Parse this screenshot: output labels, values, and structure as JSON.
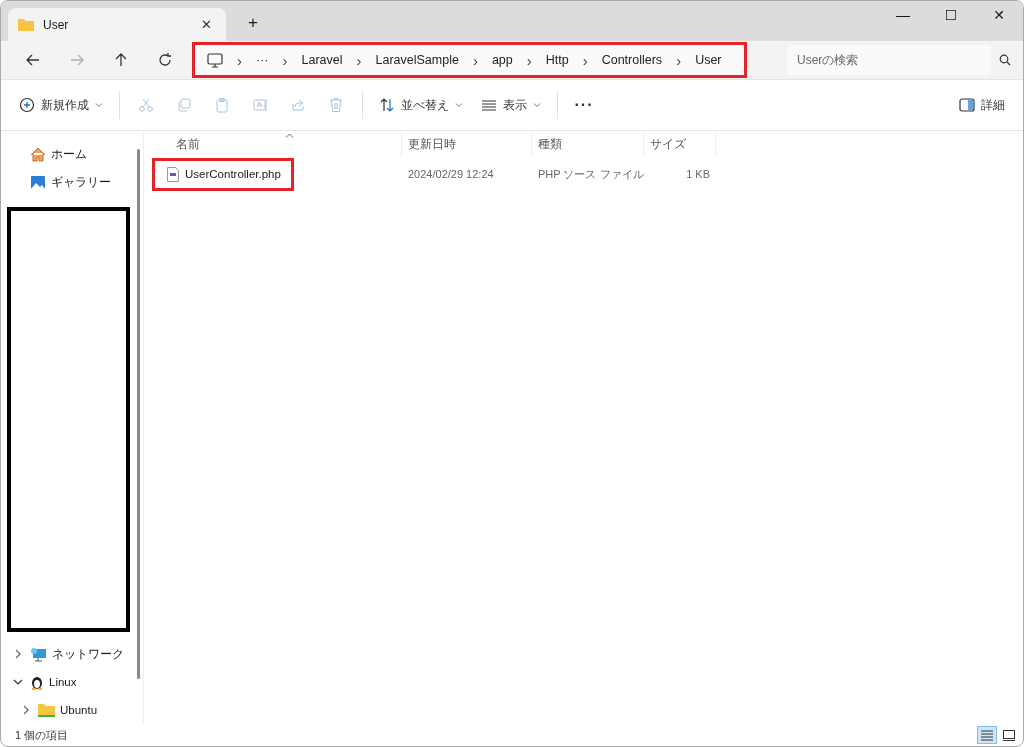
{
  "tab": {
    "title": "User",
    "close": "✕",
    "new_tab": "+"
  },
  "window_controls": {
    "minimize": "—",
    "maximize": "☐",
    "close": "✕"
  },
  "nav": {
    "back_disabled": false,
    "forward_disabled": true
  },
  "breadcrumb": {
    "highlighted": true,
    "overflow": "···",
    "separator": "›",
    "items": [
      "Laravel",
      "LaravelSample",
      "app",
      "Http",
      "Controllers",
      "User"
    ]
  },
  "search": {
    "placeholder": "Userの検索"
  },
  "toolbar": [
    {
      "kind": "new",
      "label": "新規作成",
      "disabled": false
    },
    {
      "kind": "cut",
      "disabled": true
    },
    {
      "kind": "copy",
      "disabled": true
    },
    {
      "kind": "paste",
      "disabled": true
    },
    {
      "kind": "rename",
      "disabled": true
    },
    {
      "kind": "share",
      "disabled": true
    },
    {
      "kind": "delete",
      "disabled": true
    },
    {
      "kind": "sort",
      "label": "並べ替え",
      "disabled": false
    },
    {
      "kind": "view",
      "label": "表示",
      "disabled": false
    },
    {
      "kind": "more",
      "label": "···",
      "disabled": false
    }
  ],
  "details_button": "詳細",
  "sidebar": {
    "items": [
      {
        "kind": "home",
        "label": "ホーム"
      },
      {
        "kind": "gallery",
        "label": "ギャラリー"
      },
      {
        "kind": "redacted"
      },
      {
        "kind": "network",
        "label": "ネットワーク",
        "expanded": false
      },
      {
        "kind": "linux",
        "label": "Linux",
        "expanded": true,
        "children": [
          {
            "kind": "folder",
            "label": "Ubuntu",
            "expanded": false
          }
        ]
      }
    ]
  },
  "table": {
    "columns": [
      "名前",
      "更新日時",
      "種類",
      "サイズ"
    ],
    "rows": [
      {
        "name": "UserController.php",
        "modified": "2024/02/29 12:24",
        "type": "PHP ソース ファイル",
        "size": "1 KB",
        "highlighted": true
      }
    ]
  },
  "status_bar": {
    "count": "1 個の項目",
    "views": [
      {
        "kind": "details",
        "selected": true
      },
      {
        "kind": "tiles",
        "selected": false
      }
    ]
  }
}
